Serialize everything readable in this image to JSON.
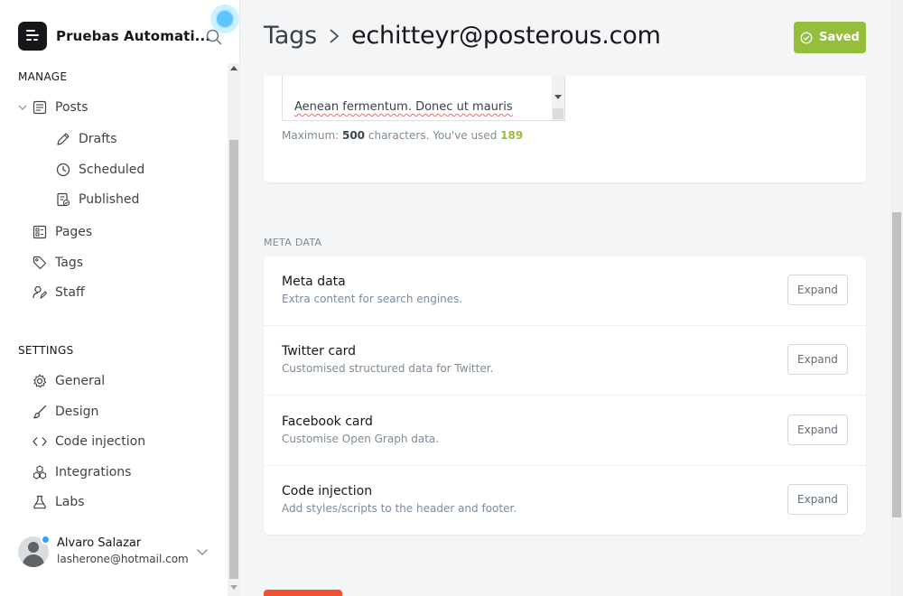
{
  "sidebar": {
    "site_title": "Pruebas Automati...",
    "manage_heading": "MANAGE",
    "settings_heading": "SETTINGS",
    "items": {
      "posts": "Posts",
      "drafts": "Drafts",
      "scheduled": "Scheduled",
      "published": "Published",
      "pages": "Pages",
      "tags": "Tags",
      "staff": "Staff",
      "general": "General",
      "design": "Design",
      "code_injection": "Code injection",
      "integrations": "Integrations",
      "labs": "Labs"
    },
    "user": {
      "name": "Alvaro Salazar",
      "email": "lasherone@hotmail.com"
    }
  },
  "header": {
    "breadcrumb_parent": "Tags",
    "breadcrumb_current": "echitteyr@posterous.com",
    "saved_label": "Saved",
    "saved_color": "#94be3c"
  },
  "description": {
    "textarea_visible_text": "Aenean fermentum. Donec ut mauris",
    "count_prefix": "Maximum: ",
    "max_chars": "500",
    "count_middle": " characters. You've used ",
    "used_chars": "189"
  },
  "meta": {
    "section_heading": "META DATA",
    "expand_label": "Expand",
    "rows": [
      {
        "title": "Meta data",
        "description": "Extra content for search engines."
      },
      {
        "title": "Twitter card",
        "description": "Customised structured data for Twitter."
      },
      {
        "title": "Facebook card",
        "description": "Customise Open Graph data."
      },
      {
        "title": "Code injection",
        "description": "Add styles/scripts to the header and footer."
      }
    ]
  },
  "colors": {
    "accent_green": "#94be3c",
    "delete_red": "#f05230",
    "notification_blue": "#5dc4ff"
  }
}
